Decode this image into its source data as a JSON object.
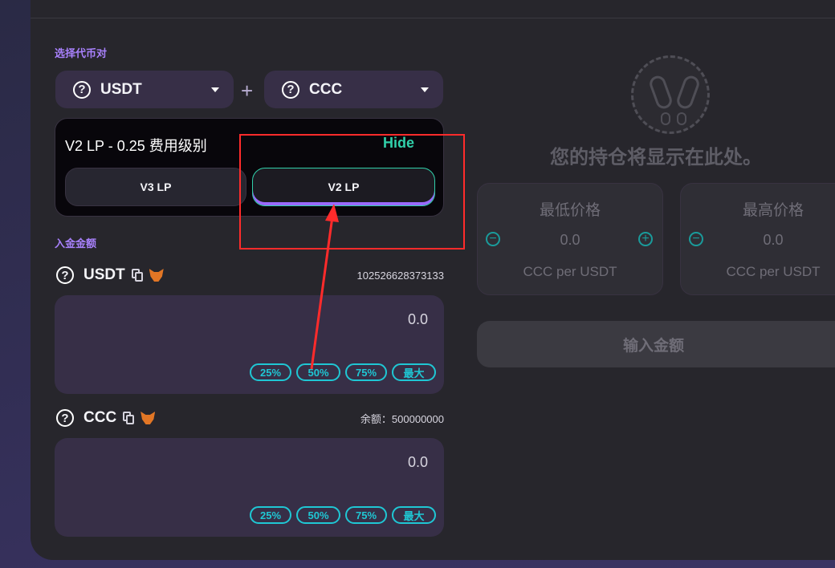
{
  "pair_section": {
    "label": "选择代币对",
    "token_a": {
      "symbol": "USDT",
      "icon": "question-circle"
    },
    "token_b": {
      "symbol": "CCC",
      "icon": "question-circle"
    },
    "separator": "+"
  },
  "fee_tier": {
    "title": "V2 LP - 0.25 费用级别",
    "hide_label": "Hide",
    "options": [
      {
        "label": "V3 LP",
        "selected": false
      },
      {
        "label": "V2 LP",
        "selected": true
      }
    ]
  },
  "deposit_section": {
    "label": "入金金额",
    "inputs": [
      {
        "symbol": "USDT",
        "balance": "102526628373133",
        "value": "0.0"
      },
      {
        "symbol": "CCC",
        "balance": "余额：500000000",
        "value": "0.0"
      }
    ],
    "percent_buttons": [
      "25%",
      "50%",
      "75%",
      "最大"
    ]
  },
  "position_panel": {
    "placeholder": "您的持仓将显示在此处。",
    "min_price": {
      "title": "最低价格",
      "value": "0.0",
      "unit": "CCC per USDT"
    },
    "max_price": {
      "title": "最高价格",
      "value": "0.0",
      "unit": "CCC per USDT"
    },
    "submit_label": "输入金额"
  },
  "colors": {
    "accent_purple": "#a881fc",
    "accent_teal": "#1fc7d4",
    "hide_green": "#31d0aa",
    "annotation_red": "#ff2b2b"
  }
}
